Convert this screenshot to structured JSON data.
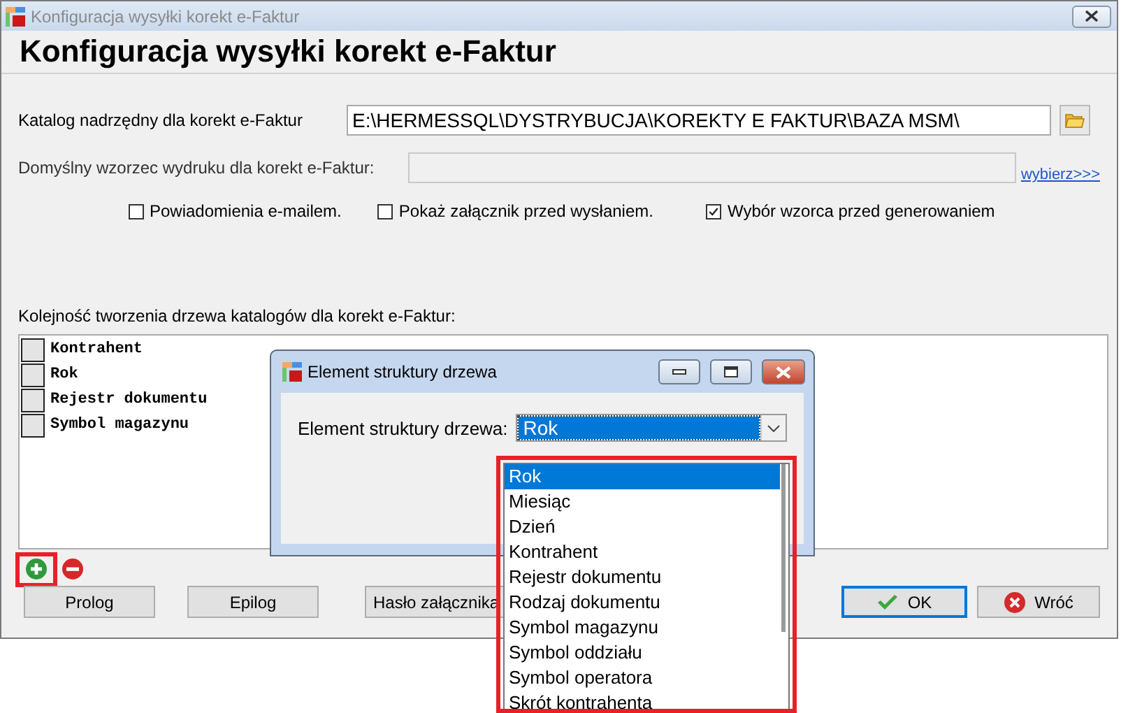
{
  "window": {
    "title": "Konfiguracja wysyłki korekt e-Faktur"
  },
  "heading": "Konfiguracja wysyłki korekt e-Faktur",
  "catalog": {
    "label": "Katalog nadrzędny dla korekt e-Faktur",
    "value": "E:\\HERMESSQL\\DYSTRYBUCJA\\KOREKTY E FAKTUR\\BAZA MSM\\"
  },
  "template": {
    "label": "Domyślny wzorzec wydruku dla korekt e-Faktur:",
    "link": "wybierz>>>"
  },
  "checkboxes": [
    {
      "label": "Powiadomienia e-mailem.",
      "checked": false
    },
    {
      "label": "Pokaż załącznik przed wysłaniem.",
      "checked": false
    },
    {
      "label": "Wybór wzorca przed generowaniem",
      "checked": true
    }
  ],
  "tree_order": {
    "label": "Kolejność tworzenia drzewa katalogów dla korekt e-Faktur:",
    "items": [
      "Kontrahent",
      "Rok",
      "Rejestr dokumentu",
      "Symbol magazynu"
    ]
  },
  "buttons": [
    {
      "label": "Prolog",
      "kind": "plain",
      "default": false
    },
    {
      "label": "Epilog",
      "kind": "plain",
      "default": false
    },
    {
      "label": "Hasło załącznika",
      "kind": "plain",
      "default": false
    },
    {
      "label": "OK",
      "kind": "ok",
      "default": true
    },
    {
      "label": "Wróć",
      "kind": "cancel",
      "default": false
    }
  ],
  "dialog": {
    "title": "Element struktury drzewa",
    "field_label": "Element struktury drzewa:",
    "value": "Rok",
    "options": [
      {
        "label": "Rok",
        "selected": true
      },
      {
        "label": "Miesiąc",
        "selected": false
      },
      {
        "label": "Dzień",
        "selected": false
      },
      {
        "label": "Kontrahent",
        "selected": false
      },
      {
        "label": "Rejestr dokumentu",
        "selected": false
      },
      {
        "label": "Rodzaj dokumentu",
        "selected": false
      },
      {
        "label": "Symbol magazynu",
        "selected": false
      },
      {
        "label": "Symbol oddziału",
        "selected": false
      },
      {
        "label": "Symbol operatora",
        "selected": false
      },
      {
        "label": "Skrót kontrahenta",
        "selected": false
      }
    ]
  }
}
